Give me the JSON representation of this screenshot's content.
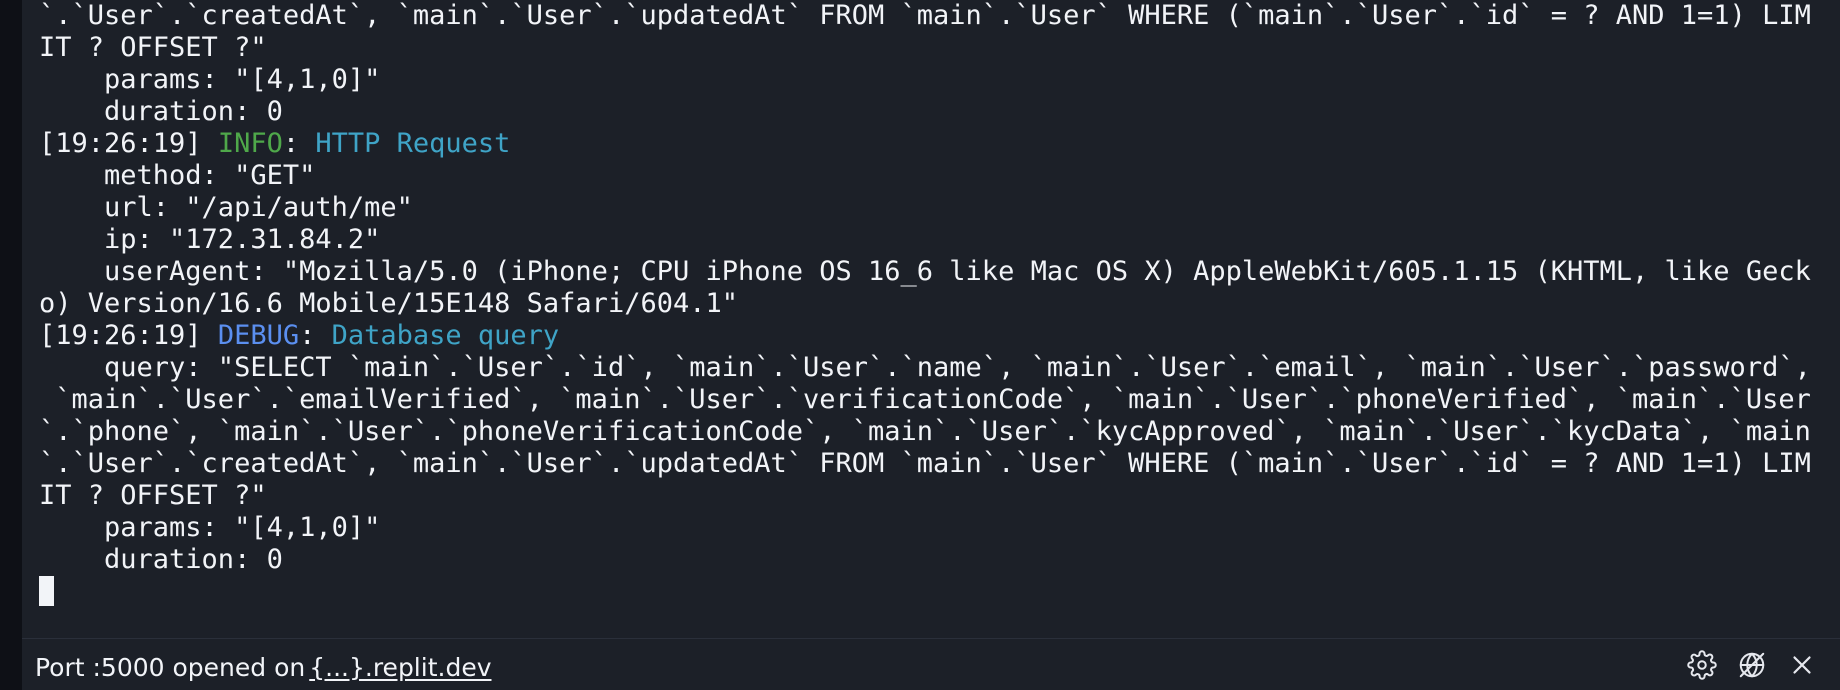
{
  "terminal": {
    "lines": [
      [
        {
          "t": " `.`phone`, `main`.`User`.`phoneVerificationCode`, `main`.`User`.`kycApproved`, `main`.`User`.`kycData`, `main",
          "c": ""
        }
      ],
      [
        {
          "t": "`.`User`.`createdAt`, `main`.`User`.`updatedAt` FROM `main`.`User` WHERE (`main`.`User`.`id` = ? AND 1=1) LIM",
          "c": ""
        }
      ],
      [
        {
          "t": "IT ? OFFSET ?\"",
          "c": ""
        }
      ],
      [
        {
          "t": "    params: \"[4,1,0]\"",
          "c": ""
        }
      ],
      [
        {
          "t": "    duration: 0",
          "c": ""
        }
      ],
      [
        {
          "t": "[19:26:19] ",
          "c": ""
        },
        {
          "t": "INFO",
          "c": "lvl-info"
        },
        {
          "t": ": ",
          "c": ""
        },
        {
          "t": "HTTP Request",
          "c": "msg"
        }
      ],
      [
        {
          "t": "    method: \"GET\"",
          "c": ""
        }
      ],
      [
        {
          "t": "    url: \"/api/auth/me\"",
          "c": ""
        }
      ],
      [
        {
          "t": "    ip: \"172.31.84.2\"",
          "c": ""
        }
      ],
      [
        {
          "t": "    userAgent: \"Mozilla/5.0 (iPhone; CPU iPhone OS 16_6 like Mac OS X) AppleWebKit/605.1.15 (KHTML, like Geck",
          "c": ""
        }
      ],
      [
        {
          "t": "o) Version/16.6 Mobile/15E148 Safari/604.1\"",
          "c": ""
        }
      ],
      [
        {
          "t": "[19:26:19] ",
          "c": ""
        },
        {
          "t": "DEBUG",
          "c": "lvl-debug"
        },
        {
          "t": ": ",
          "c": ""
        },
        {
          "t": "Database query",
          "c": "msg"
        }
      ],
      [
        {
          "t": "    query: \"SELECT `main`.`User`.`id`, `main`.`User`.`name`, `main`.`User`.`email`, `main`.`User`.`password`,",
          "c": ""
        }
      ],
      [
        {
          "t": " `main`.`User`.`emailVerified`, `main`.`User`.`verificationCode`, `main`.`User`.`phoneVerified`, `main`.`User",
          "c": ""
        }
      ],
      [
        {
          "t": "`.`phone`, `main`.`User`.`phoneVerificationCode`, `main`.`User`.`kycApproved`, `main`.`User`.`kycData`, `main",
          "c": ""
        }
      ],
      [
        {
          "t": "`.`User`.`createdAt`, `main`.`User`.`updatedAt` FROM `main`.`User` WHERE (`main`.`User`.`id` = ? AND 1=1) LIM",
          "c": ""
        }
      ],
      [
        {
          "t": "IT ? OFFSET ?\"",
          "c": ""
        }
      ],
      [
        {
          "t": "    params: \"[4,1,0]\"",
          "c": ""
        }
      ],
      [
        {
          "t": "    duration: 0",
          "c": ""
        }
      ]
    ]
  },
  "statusbar": {
    "port_text": "Port :5000 opened on",
    "link_text": "{...}.replit.dev",
    "icons": [
      "gear-icon",
      "no-preview-icon",
      "close-icon"
    ]
  },
  "colors": {
    "background": "#1c2028",
    "text": "#f2f4f8",
    "info": "#4fa84a",
    "debug": "#5b8ff0",
    "message": "#3fa4c7"
  }
}
